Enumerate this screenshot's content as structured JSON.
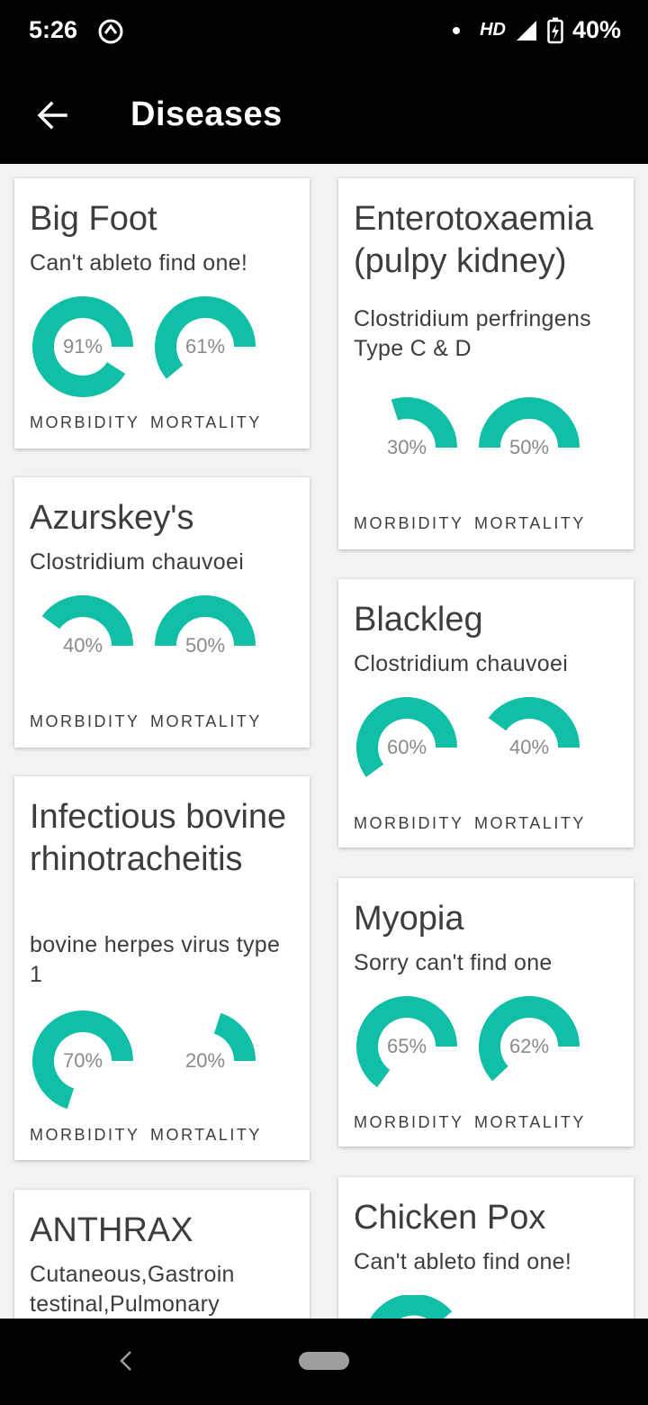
{
  "status": {
    "time": "5:26",
    "network": "HD",
    "battery": "40%"
  },
  "appbar": {
    "title": "Diseases"
  },
  "labels": {
    "morbidity": "MORBIDITY",
    "mortality": "MORTALITY"
  },
  "colors": {
    "accent": "#10bfa5",
    "appbar": "#000000"
  },
  "cards": [
    {
      "title": "Big Foot",
      "subtitle": "Can't ableto find one!",
      "morbidity": "91%",
      "mortality": "61%",
      "morbidity_value": 91,
      "mortality_value": 61
    },
    {
      "title": "Enterotoxaemia (pulpy kidney)",
      "subtitle": "Clostridium perfringens Type C & D",
      "morbidity": "30%",
      "mortality": "50%",
      "morbidity_value": 30,
      "mortality_value": 50
    },
    {
      "title": "Azurskey's",
      "subtitle": "Clostridium chauvoei",
      "morbidity": "40%",
      "mortality": "50%",
      "morbidity_value": 40,
      "mortality_value": 50
    },
    {
      "title": "Blackleg",
      "subtitle": "Clostridium chauvoei",
      "morbidity": "60%",
      "mortality": "40%",
      "morbidity_value": 60,
      "mortality_value": 40
    },
    {
      "title": "Infectious bovine rhinotracheitis",
      "subtitle": "bovine herpes virus type 1",
      "morbidity": "70%",
      "mortality": "20%",
      "morbidity_value": 70,
      "mortality_value": 20
    },
    {
      "title": "Myopia",
      "subtitle": "Sorry can't find one",
      "morbidity": "65%",
      "mortality": "62%",
      "morbidity_value": 65,
      "mortality_value": 62
    },
    {
      "title": "ANTHRAX",
      "subtitle": "Cutaneous,Gastroin testinal,Pulmonary"
    },
    {
      "title": "Chicken Pox",
      "subtitle": "Can't ableto find one!"
    }
  ]
}
